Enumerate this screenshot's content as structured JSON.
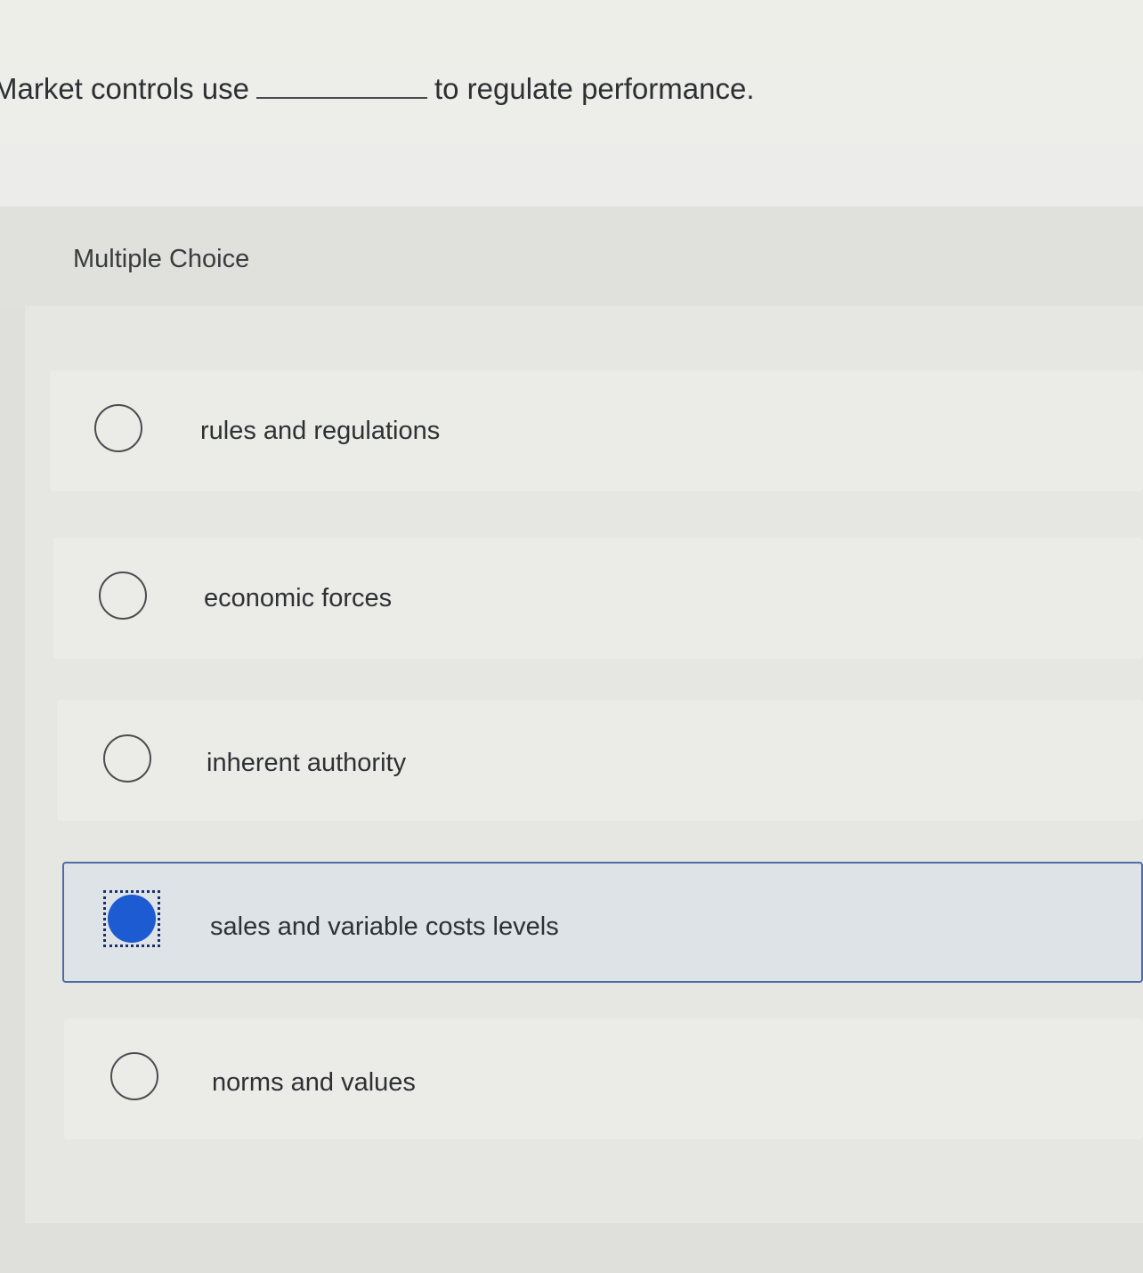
{
  "question": {
    "prefix": "Market controls use",
    "suffix": "to regulate performance."
  },
  "section_label": "Multiple Choice",
  "choices": [
    {
      "label": "rules and regulations",
      "selected": false
    },
    {
      "label": "economic forces",
      "selected": false
    },
    {
      "label": "inherent authority",
      "selected": false
    },
    {
      "label": "sales and variable costs levels",
      "selected": true
    },
    {
      "label": "norms and values",
      "selected": false
    }
  ],
  "colors": {
    "selected_fill": "#1c5bd2",
    "selected_border": "#4d6da6",
    "selected_background": "#dde3e7"
  }
}
